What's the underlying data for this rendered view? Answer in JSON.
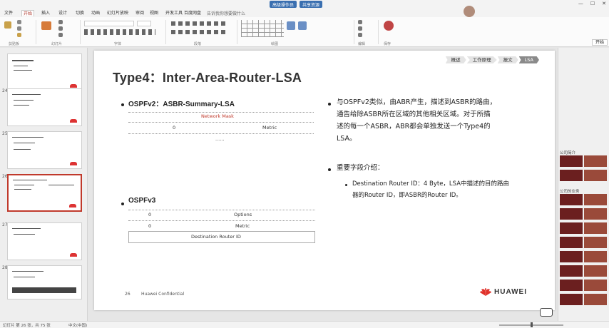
{
  "titlebar": {
    "chip_1": "高级操作员",
    "chip_2": "共享资源"
  },
  "ribbon": {
    "tabs": [
      "文件",
      "开始",
      "插入",
      "设计",
      "切换",
      "动画",
      "幻灯片放映",
      "审阅",
      "视图",
      "开发工具",
      "百度网盘"
    ],
    "active_tab": "开始",
    "search_hint": "告诉我你想要做什么",
    "avatar_button": "开始",
    "groups": [
      "剪贴板",
      "幻灯片",
      "字体",
      "段落",
      "绘图",
      "编辑",
      "保存"
    ]
  },
  "thumbnails": {
    "numbers": [
      "24",
      "25",
      "26",
      "27",
      "28"
    ],
    "selected_index": 2
  },
  "slide": {
    "breadcrumbs": [
      "概述",
      "工作原理",
      "报文",
      "LSA"
    ],
    "active_crumb": 3,
    "title": "Type4：Inter-Area-Router-LSA",
    "ospfv2_label": "OSPFv2：ASBR-Summary-LSA",
    "v2_network_mask": "Network Mask",
    "v2_zero": "0",
    "v2_metric": "Metric",
    "v2_dots": "......",
    "ospfv3_label": "OSPFv3",
    "v3_zero_1": "0",
    "v3_options": "Options",
    "v3_zero_2": "0",
    "v3_metric": "Metric",
    "v3_dest": "Destination Router ID",
    "right_para_lines": [
      "与OSPFv2类似，由ABR产生，描述到ASBR的路由，",
      "通告给除ASBR所在区域的其他相关区域。对于所描",
      "述的每一个ASBR，ABR都会单独发送一个Type4的",
      "LSA。"
    ],
    "important_fields": "重要字段介绍：",
    "dest_field_lines": [
      "Destination Router ID：4 Byte，LSA中描述的目的路由",
      "器的Router ID，即ASBR的Router ID。"
    ],
    "footer_page": "26",
    "footer_conf": "Huawei Confidential",
    "logo_text": "HUAWEI"
  },
  "right_panel": {
    "label_1": "公司简介",
    "label_2": "公司的业务"
  },
  "statusbar": {
    "left": "幻灯片 第 26 张，共 75 张",
    "lang": "中文(中国)"
  },
  "colors": {
    "accent": "#c0392b",
    "huawei_red": "#e0322b"
  }
}
